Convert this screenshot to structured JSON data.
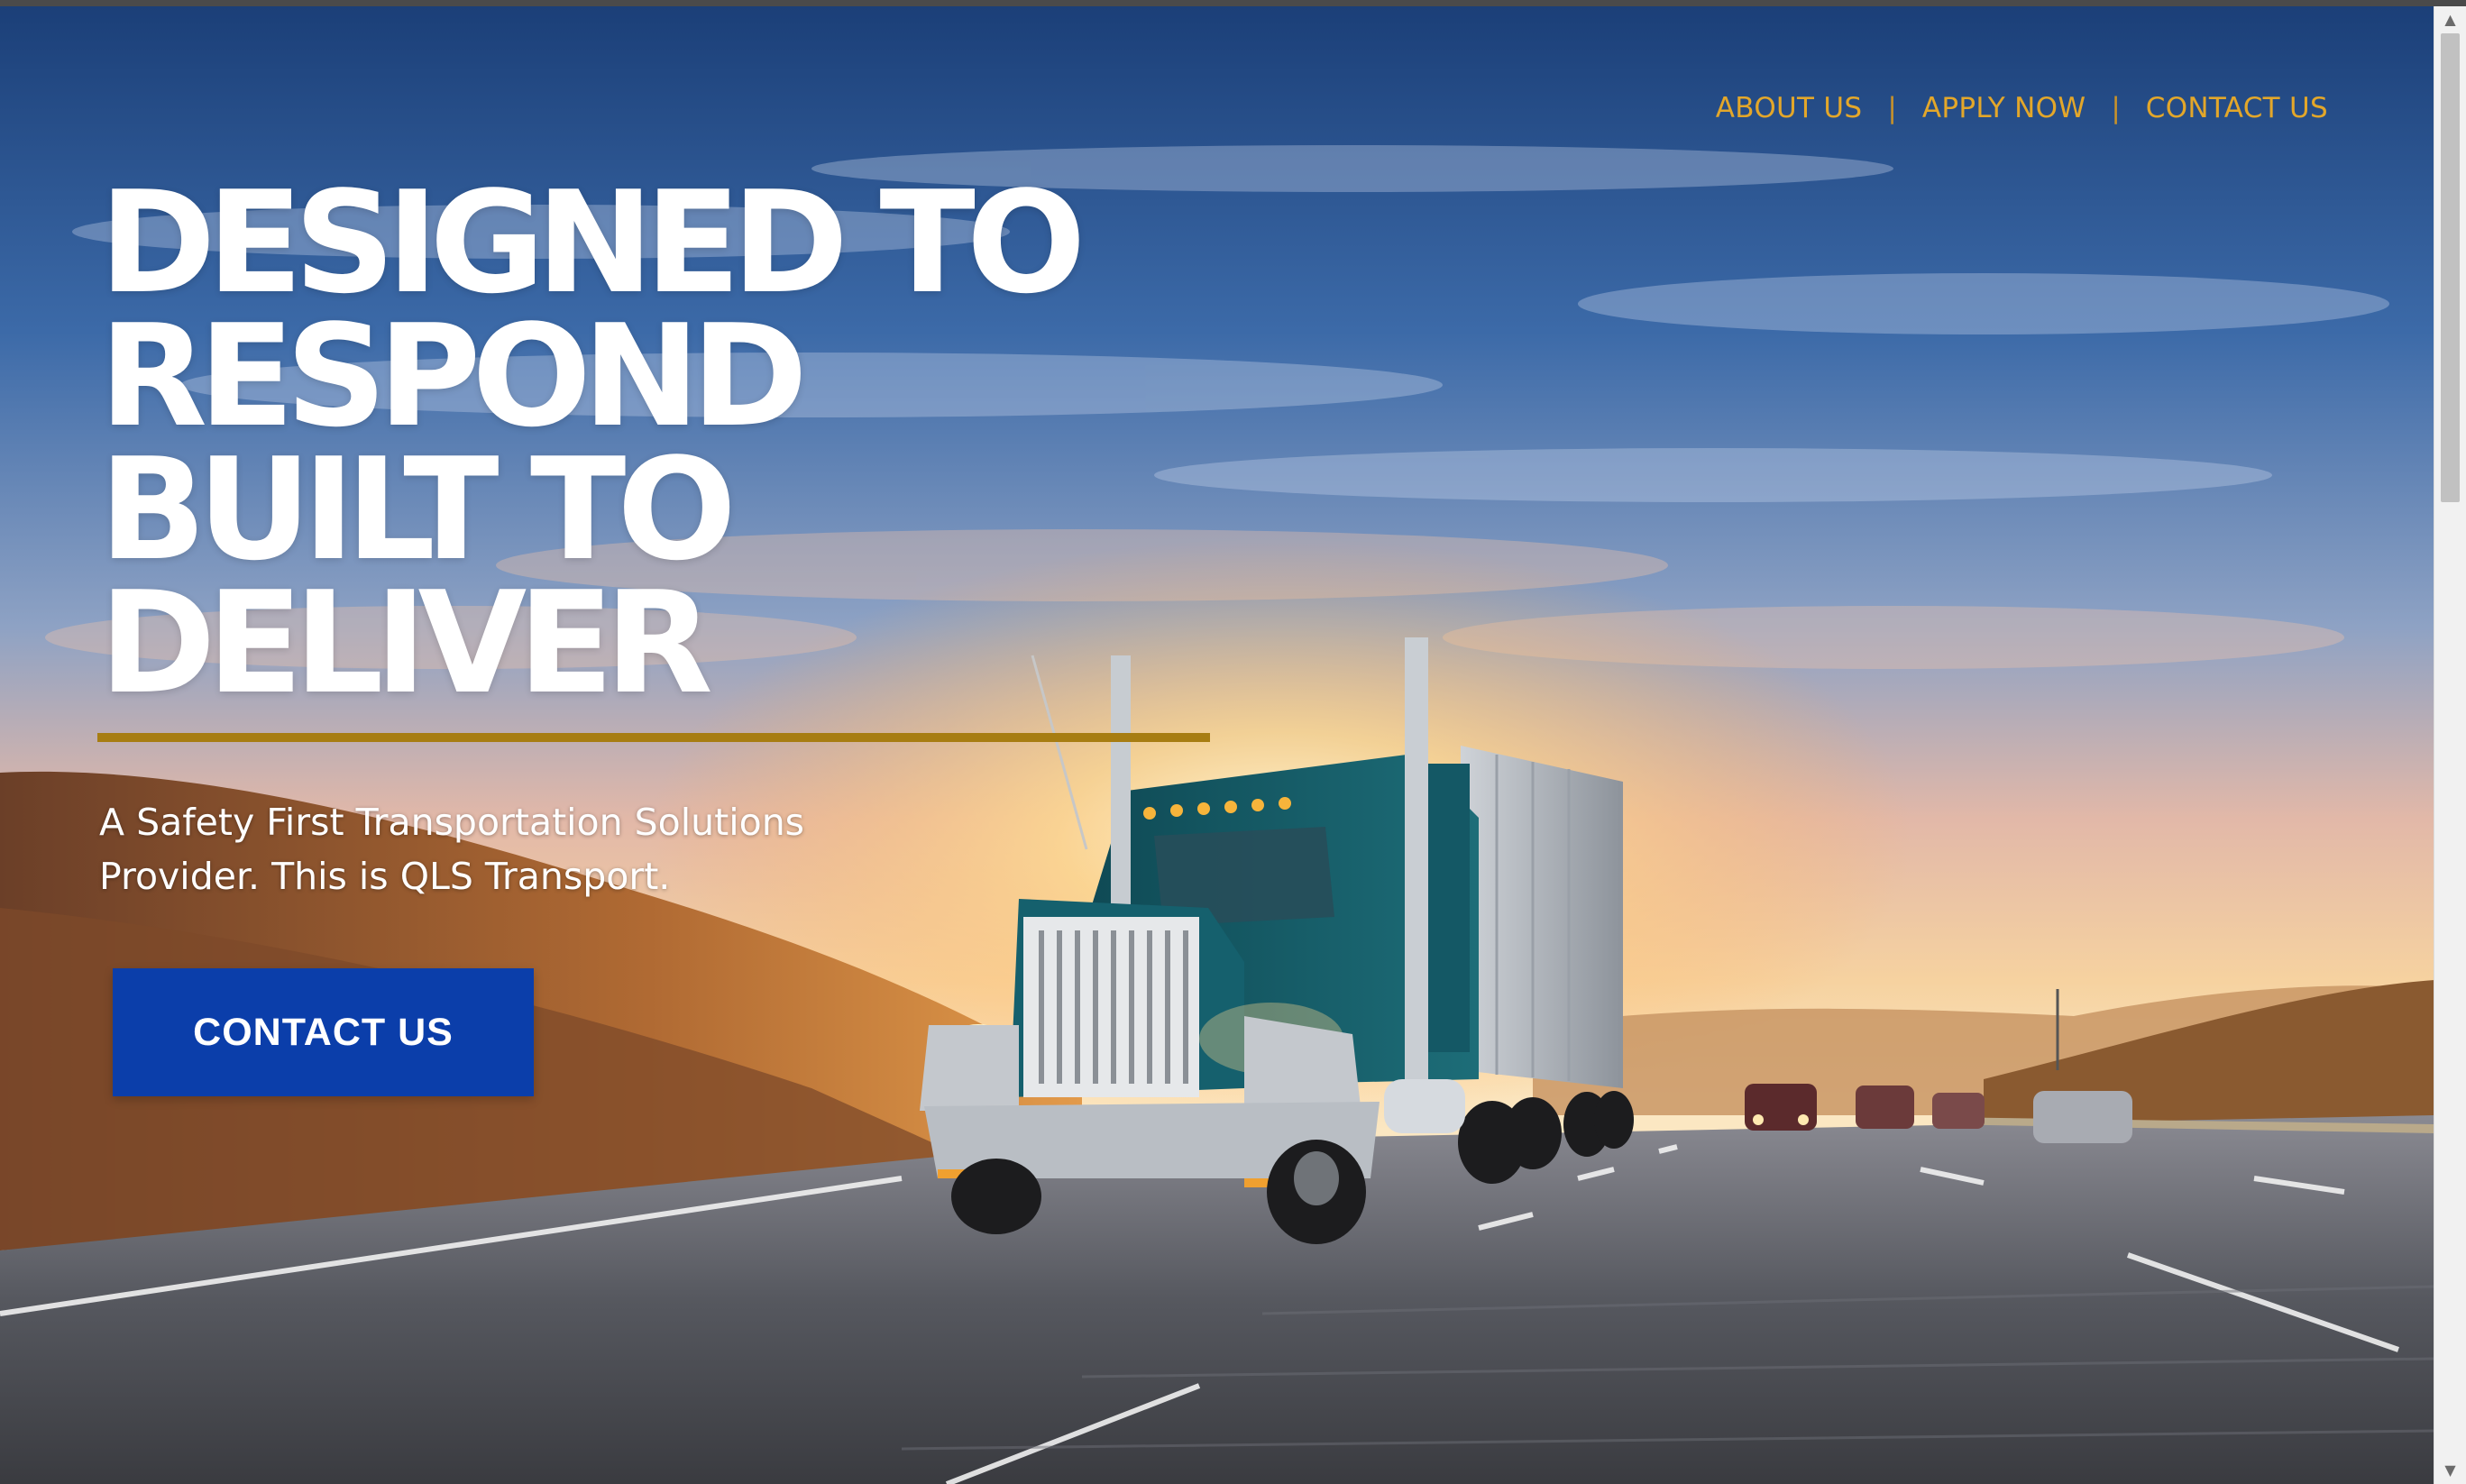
{
  "nav": {
    "items": [
      {
        "label": "ABOUT US"
      },
      {
        "label": "APPLY NOW"
      },
      {
        "label": "CONTACT US"
      }
    ],
    "separator": "|"
  },
  "hero": {
    "headline_lines": [
      "DESIGNED TO",
      "RESPOND",
      "BUILT TO",
      "DELIVER"
    ],
    "tagline": "A Safety First Transportation Solutions Provider. This is QLS Transport.",
    "cta_label": "CONTACT US",
    "background_image": "semi-truck-on-highway-at-sunset"
  },
  "colors": {
    "nav_link": "#e3a72a",
    "gold_rule": "#a77d12",
    "cta_background": "#0b3eaa",
    "headline": "#ffffff"
  },
  "scrollbar": {
    "up_icon": "scroll-up-arrow-icon",
    "down_icon": "scroll-down-arrow-icon"
  }
}
